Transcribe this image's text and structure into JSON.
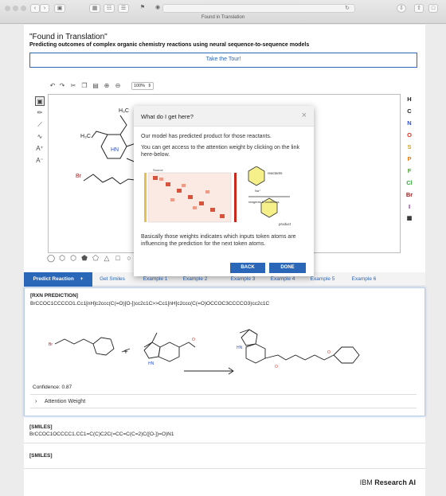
{
  "browser": {
    "tab_title": "Found in Translation"
  },
  "header": {
    "title": "\"Found in Translation\"",
    "subtitle": "Predicting outcomes of complex organic chemistry reactions using neural sequence-to-sequence models",
    "tour_button": "Take the Tour!"
  },
  "editor": {
    "zoom": "100%",
    "elements": [
      {
        "symbol": "H",
        "color": "#222222"
      },
      {
        "symbol": "C",
        "color": "#222222"
      },
      {
        "symbol": "N",
        "color": "#2b4fd8"
      },
      {
        "symbol": "O",
        "color": "#e0301e"
      },
      {
        "symbol": "S",
        "color": "#d8a020"
      },
      {
        "symbol": "P",
        "color": "#e07818"
      },
      {
        "symbol": "F",
        "color": "#4aa02c"
      },
      {
        "symbol": "Cl",
        "color": "#38a838"
      },
      {
        "symbol": "Br",
        "color": "#a02020"
      },
      {
        "symbol": "I",
        "color": "#9020a0"
      }
    ],
    "atom_labels": {
      "h3c_top": "H₃C",
      "h3c_left": "H₃C",
      "nh": "HN",
      "br": "Br"
    }
  },
  "tabs": [
    "Predict Reaction",
    "Get Smiles",
    "Example 1",
    "Example 2",
    "Example 3",
    "Example 4",
    "Example 5",
    "Example 6"
  ],
  "tab_add_icon": "+",
  "prediction": {
    "label": "[RXN PREDICTION]",
    "smiles": "BrCCOC1CCCCO1.Cc1[nH]c2ccc(C(=O)[O-])cc2c1C>>Cc1[nH]c2ccc(C(=O)OCCOC3CCCCO3)cc2c1C",
    "confidence": "Confidence: 0.87",
    "attention_label": "Attention Weight",
    "atom_labels": {
      "hn": "HN",
      "o": "O",
      "br": "Br"
    }
  },
  "smiles_card": {
    "label": "[SMILES]",
    "value": "BrCCOC1OCCCC1.CC1=C(C)C2C(=CC=C(C=2)C([O-])=O)N1"
  },
  "smiles_card2": {
    "label": "[SMILES]"
  },
  "footer": {
    "brand_plain": "IBM",
    "brand_bold": "Research AI"
  },
  "modal": {
    "title": "What do I get here?",
    "close": "×",
    "text1": "Our model has predicted product for those reactants.",
    "text2": "You can get access to the attention weight by clicking on the link here-below.",
    "text3": "Basically those weights indicates which inputs token atoms are influencing the prediction for the next token atoms.",
    "back": "BACK",
    "done": "DONE",
    "figure": {
      "source_label": "Source",
      "reactants_label": "reactants",
      "conditions_label": "reagents & conditions",
      "product_label": "product",
      "na_label": "Na⁺"
    }
  }
}
